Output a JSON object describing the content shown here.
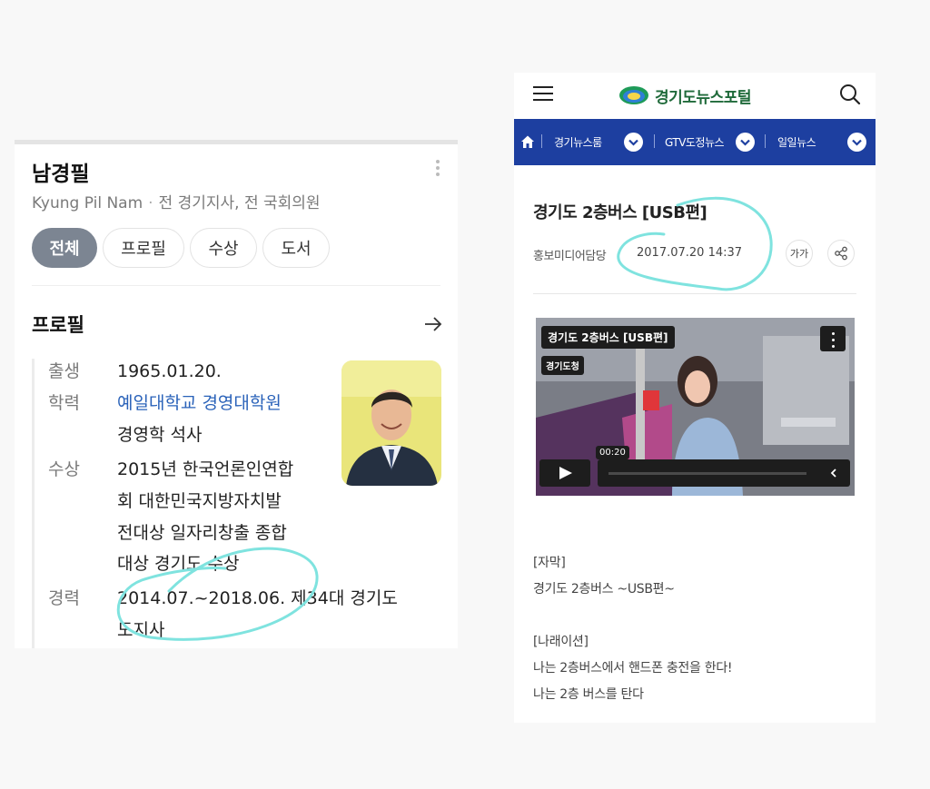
{
  "profile": {
    "name": "남경필",
    "name_en": "Kyung Pil Nam",
    "dot": "·",
    "roles": "전 경기지사, 전 국회의원",
    "tabs": [
      "전체",
      "프로필",
      "수상",
      "도서"
    ],
    "section_title": "프로필",
    "rows": {
      "birth": {
        "label": "출생",
        "value": "1965.01.20."
      },
      "edu": {
        "label": "학력",
        "link": "예일대학교 경영대학원",
        "line2": "경영학 석사"
      },
      "award": {
        "label": "수상",
        "lines": [
          "2015년 한국언론인연합",
          "회 대한민국지방자치발",
          "전대상 일자리창출 종합",
          "대상 경기도 수상"
        ]
      },
      "career": {
        "label": "경력",
        "lines": [
          "2014.07.~2018.06. 제34대 경기도",
          "도지사"
        ]
      }
    }
  },
  "news": {
    "portal_name": "경기도뉴스포털",
    "nav": [
      "경기뉴스룸",
      "GTV도정뉴스",
      "일일뉴스"
    ],
    "article_title": "경기도 2층버스 [USB편]",
    "department": "홍보미디어담당",
    "date": "2017.07.20 14:37",
    "font_btn": "가가",
    "video": {
      "title": "경기도 2층버스 [USB편]",
      "channel": "경기도청",
      "time": "00:20"
    },
    "captions": {
      "subtitle_tag": "[자막]",
      "subtitle_text": "경기도 2층버스 ~USB편~",
      "narration_tag": "[나래이션]",
      "narration_1": "나는 2층버스에서 핸드폰 충전을 한다!",
      "narration_2": "나는 2층 버스를 탄다"
    }
  },
  "colors": {
    "nav_blue": "#1d3fa0",
    "active_tab": "#7c8592",
    "link_blue": "#2a62b9",
    "annotation": "#7fe3df"
  }
}
